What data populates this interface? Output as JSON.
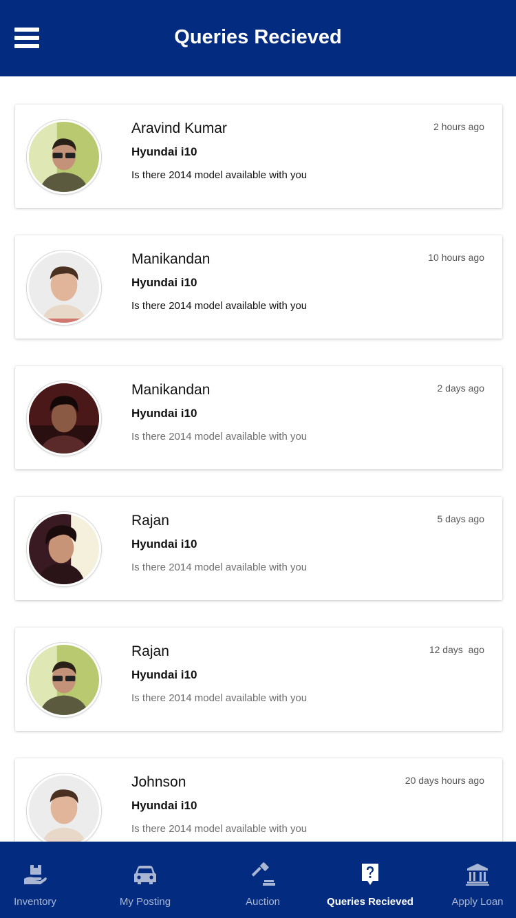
{
  "header": {
    "title": "Queries Recieved",
    "menu_icon": "hamburger-menu-icon"
  },
  "queries": [
    {
      "name": "Aravind Kumar",
      "car": "Hyundai i10",
      "message": "Is there 2014 model available with you",
      "time": "2 hours ago",
      "unread": true
    },
    {
      "name": "Manikandan",
      "car": "Hyundai i10",
      "message": "Is there 2014 model available with you",
      "time": "10 hours ago",
      "unread": true
    },
    {
      "name": "Manikandan",
      "car": "Hyundai i10",
      "message": "Is there 2014 model available with you",
      "time": "2 days ago",
      "unread": false
    },
    {
      "name": "Rajan",
      "car": "Hyundai i10",
      "message": "Is there 2014 model available with you",
      "time": "5 days ago",
      "unread": false
    },
    {
      "name": "Rajan",
      "car": "Hyundai i10",
      "message": "Is there 2014 model available with you",
      "time": "12 days  ago",
      "unread": false
    },
    {
      "name": "Johnson",
      "car": "Hyundai i10",
      "message": "Is there 2014 model available with you",
      "time": "20 days hours ago",
      "unread": false
    }
  ],
  "nav": [
    {
      "label": "Inventory",
      "icon": "hand-box-icon",
      "active": false
    },
    {
      "label": "My Posting",
      "icon": "car-icon",
      "active": false
    },
    {
      "label": "Auction",
      "icon": "gavel-icon",
      "active": false
    },
    {
      "label": "Queries Recieved",
      "icon": "question-icon",
      "active": true
    },
    {
      "label": "Apply Loan",
      "icon": "bank-icon",
      "active": false
    }
  ],
  "colors": {
    "primary": "#032b7f",
    "nav_inactive": "#a9b6d4",
    "nav_active": "#ffffff"
  }
}
